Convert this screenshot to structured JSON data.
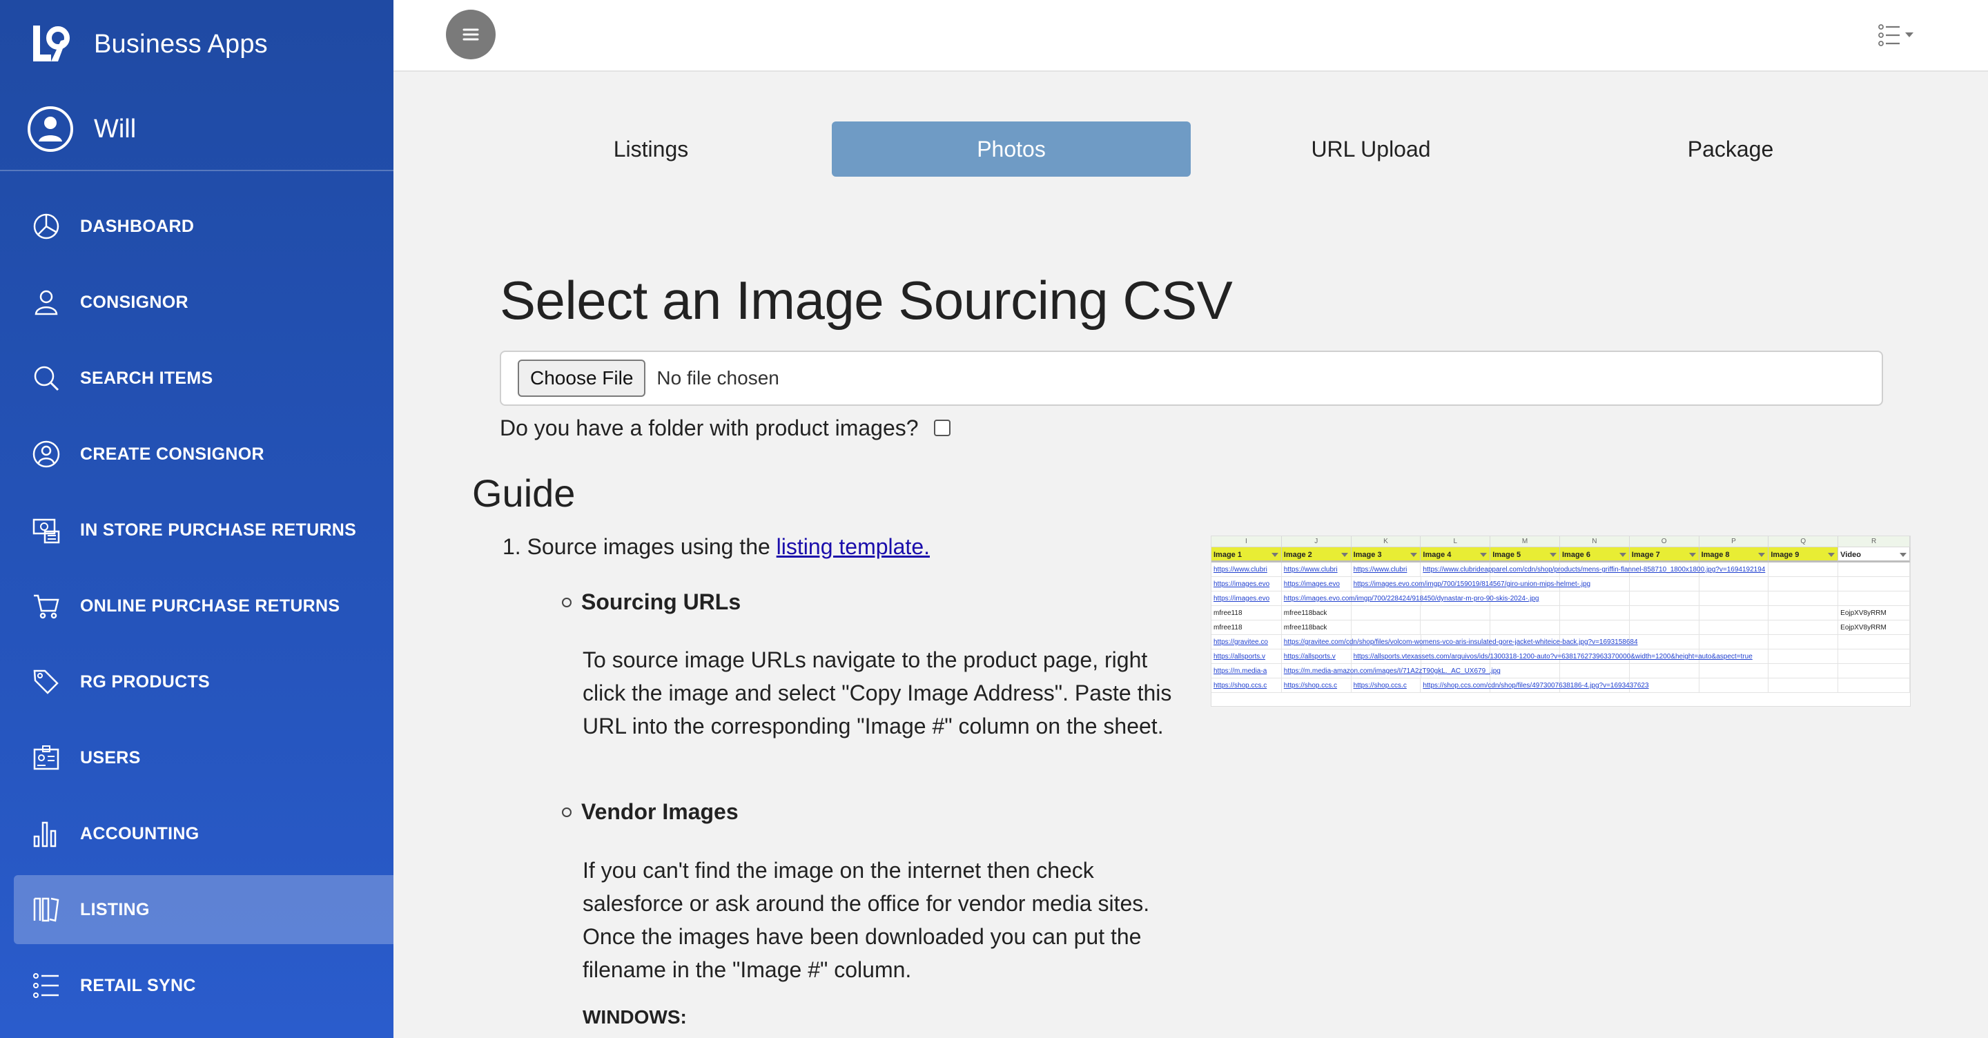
{
  "brand": {
    "name": "Business Apps"
  },
  "user": {
    "name": "Will"
  },
  "nav": [
    {
      "label": "DASHBOARD",
      "icon": "pie-chart-icon"
    },
    {
      "label": "CONSIGNOR",
      "icon": "person-icon"
    },
    {
      "label": "SEARCH ITEMS",
      "icon": "search-icon"
    },
    {
      "label": "CREATE CONSIGNOR",
      "icon": "user-circle-icon"
    },
    {
      "label": "IN STORE PURCHASE RETURNS",
      "icon": "cash-register-icon"
    },
    {
      "label": "ONLINE PURCHASE RETURNS",
      "icon": "cart-icon"
    },
    {
      "label": "RG PRODUCTS",
      "icon": "tags-icon"
    },
    {
      "label": "USERS",
      "icon": "id-badge-icon"
    },
    {
      "label": "ACCOUNTING",
      "icon": "bar-chart-icon"
    },
    {
      "label": "LISTING",
      "icon": "listing-icon",
      "active": true
    },
    {
      "label": "RETAIL SYNC",
      "icon": "list-icon"
    }
  ],
  "tabs": [
    {
      "label": "Listings"
    },
    {
      "label": "Photos",
      "active": true
    },
    {
      "label": "URL Upload"
    },
    {
      "label": "Package"
    }
  ],
  "page": {
    "title": "Select an Image Sourcing CSV",
    "file_button": "Choose File",
    "file_status": "No file chosen",
    "folder_question": "Do you have a folder with product images?"
  },
  "guide": {
    "title": "Guide",
    "step1_prefix": "1. Source images using the ",
    "step1_link": "listing template.",
    "sourcing_title": "Sourcing URLs",
    "sourcing_text": "To source image URLs navigate to the product page, right click the image and select \"Copy Image Address\". Paste this URL into the corresponding \"Image #\" column on the sheet.",
    "vendor_title": "Vendor Images",
    "vendor_text": "If you can't find the image on the internet then check salesforce or ask around the office for vendor media sites. Once the images have been downloaded you can put the filename in the \"Image #\" column.",
    "windows_label": "WINDOWS:"
  },
  "sheet": {
    "letters": [
      "I",
      "J",
      "K",
      "L",
      "M",
      "N",
      "O",
      "P",
      "Q",
      "R"
    ],
    "headers": [
      "Image 1",
      "Image 2",
      "Image 3",
      "Image 4",
      "Image 5",
      "Image 6",
      "Image 7",
      "Image 8",
      "Image 9",
      "Video"
    ],
    "rows": [
      [
        "https://www.clubri",
        "https://www.clubri",
        "https://www.clubri",
        "https://www.clubrideapparel.com/cdn/shop/products/mens-griffin-flannel-858710_1800x1800.jpg?v=1694192194",
        "",
        "",
        "",
        "",
        "",
        ""
      ],
      [
        "https://images.evo",
        "https://images.evo",
        "https://images.evo.com/imgp/700/159019/814567/giro-union-mips-helmet-.jpg",
        "",
        "",
        "",
        "",
        "",
        "",
        ""
      ],
      [
        "https://images.evo",
        "https://images.evo.com/imgp/700/228424/918450/dynastar-m-pro-90-skis-2024-.jpg",
        "",
        "",
        "",
        "",
        "",
        "",
        "",
        ""
      ],
      [
        "mfree118",
        "mfree118back",
        "",
        "",
        "",
        "",
        "",
        "",
        "",
        "EojpXV8yRRM"
      ],
      [
        "mfree118",
        "mfree118back",
        "",
        "",
        "",
        "",
        "",
        "",
        "",
        "EojpXV8yRRM"
      ],
      [
        "https://gravitee.co",
        "https://gravitee.com/cdn/shop/files/volcom-womens-vco-aris-insulated-gore-jacket-whiteice-back.jpg?v=1693158684",
        "",
        "",
        "",
        "",
        "",
        "",
        "",
        ""
      ],
      [
        "https://allsports.v",
        "https://allsports.v",
        "https://allsports.vtexassets.com/arquivos/ids/1300318-1200-auto?v=638176273963370000&width=1200&height=auto&aspect=true",
        "",
        "",
        "",
        "",
        "",
        "",
        ""
      ],
      [
        "https://m.media-a",
        "https://m.media-amazon.com/images/I/71A2zT90gkL._AC_UX679_.jpg",
        "",
        "",
        "",
        "",
        "",
        "",
        "",
        ""
      ],
      [
        "https://shop.ccs.c",
        "https://shop.ccs.c",
        "https://shop.ccs.c",
        "https://shop.ccs.com/cdn/shop/files/4973007638186-4.jpg?v=1693437623",
        "",
        "",
        "",
        "",
        "",
        ""
      ]
    ]
  },
  "colors": {
    "sidebar_top": "#1f4aa3",
    "sidebar_bottom": "#2a5ccc",
    "tab_active": "#6f9bc5",
    "link": "#1a0dab"
  }
}
